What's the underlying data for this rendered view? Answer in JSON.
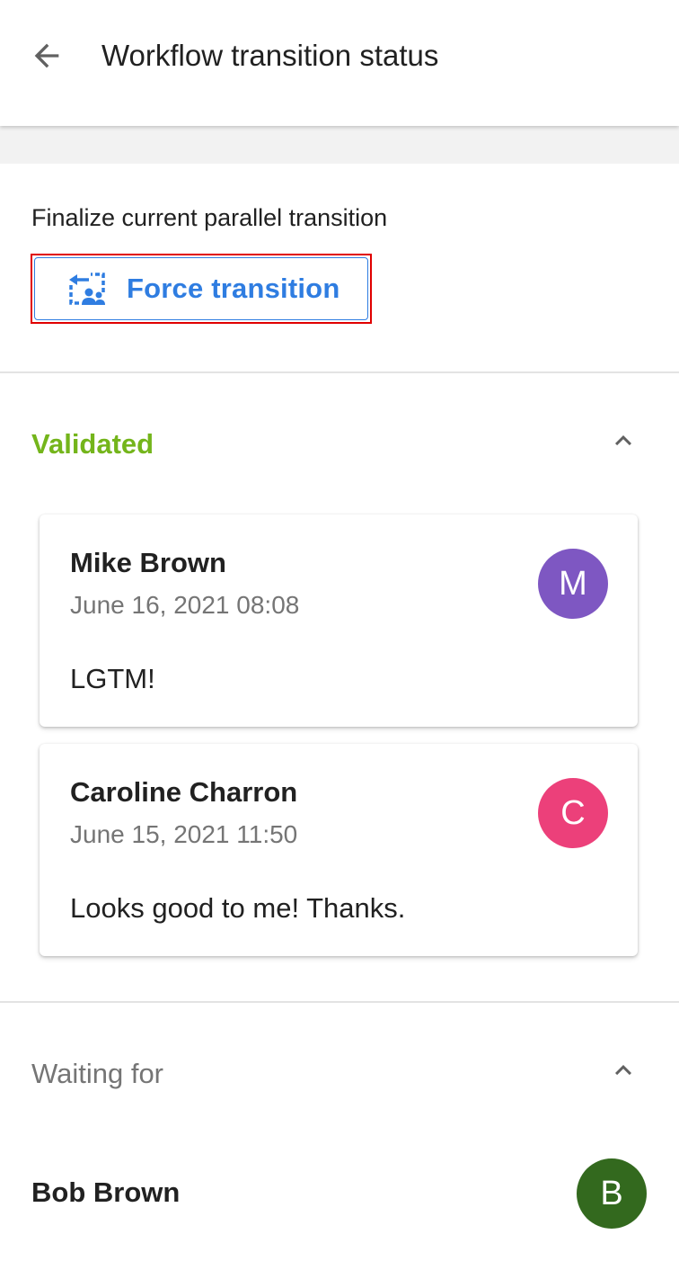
{
  "app_bar": {
    "title": "Workflow transition status",
    "back_icon": "arrow-left-icon"
  },
  "finalize": {
    "text": "Finalize current parallel transition",
    "button_label": "Force transition",
    "button_icon": "force-transition-icon",
    "accent_color": "#2f7de1"
  },
  "validated": {
    "title": "Validated",
    "color": "#74b51b",
    "entries": [
      {
        "name": "Mike Brown",
        "date": "June 16, 2021 08:08",
        "comment": "LGTM!",
        "initial": "M",
        "avatar_color": "#7e57c2"
      },
      {
        "name": "Caroline Charron",
        "date": "June 15, 2021 11:50",
        "comment": "Looks good to me! Thanks.",
        "initial": "C",
        "avatar_color": "#ec407a"
      }
    ]
  },
  "waiting": {
    "title": "Waiting for",
    "users": [
      {
        "name": "Bob Brown",
        "initial": "B",
        "avatar_color": "#33691e"
      }
    ]
  }
}
